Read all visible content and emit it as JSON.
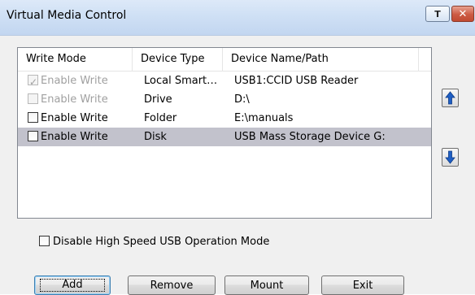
{
  "window": {
    "title": "Virtual Media Control",
    "pin_label": "T",
    "close_label": "✕"
  },
  "listview": {
    "columns": [
      "Write Mode",
      "Device Type",
      "Device Name/Path"
    ],
    "rows": [
      {
        "write_mode": "Enable Write",
        "checked": true,
        "enabled": false,
        "selected": false,
        "device_type": "Local Smart…",
        "device_name": "USB1:CCID USB Reader"
      },
      {
        "write_mode": "Enable Write",
        "checked": false,
        "enabled": false,
        "selected": false,
        "device_type": "Drive",
        "device_name": "D:\\"
      },
      {
        "write_mode": "Enable Write",
        "checked": false,
        "enabled": true,
        "selected": false,
        "device_type": "Folder",
        "device_name": "E:\\manuals"
      },
      {
        "write_mode": "Enable Write",
        "checked": false,
        "enabled": true,
        "selected": true,
        "device_type": "Disk",
        "device_name": "USB Mass Storage Device G:"
      }
    ]
  },
  "options": {
    "disable_high_speed_label": "Disable High Speed USB Operation Mode",
    "disable_high_speed_checked": false
  },
  "buttons": {
    "add": "Add",
    "remove": "Remove",
    "mount": "Mount",
    "exit": "Exit"
  },
  "colors": {
    "selected_row": "#c2c2cc",
    "arrow_blue": "#1f5fc4",
    "title_bar": "#cfe0f5",
    "close_red": "#cc5a43"
  },
  "icons": {
    "move_up": "arrow-up-icon",
    "move_down": "arrow-down-icon"
  }
}
